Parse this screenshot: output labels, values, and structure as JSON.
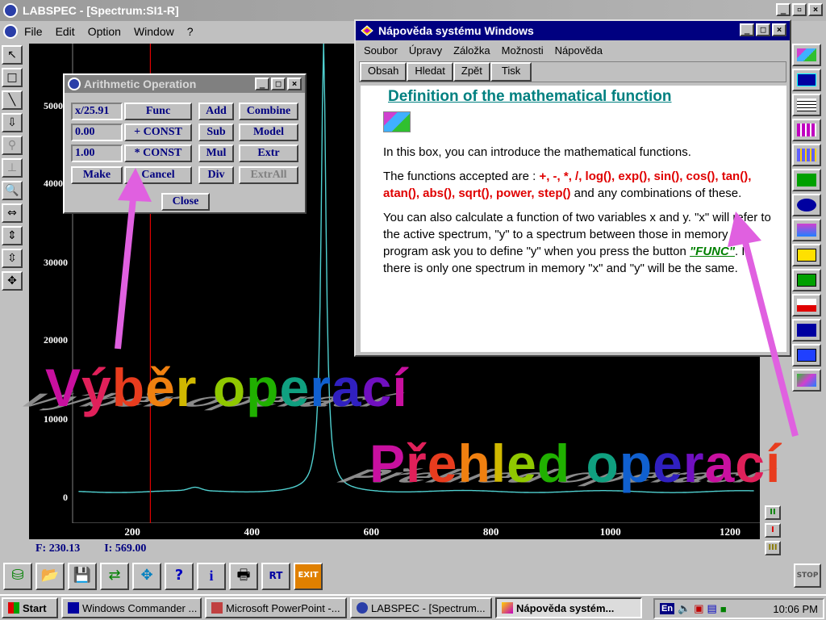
{
  "main_window": {
    "title": "LABSPEC - [Spectrum:SI1-R]",
    "menu": [
      "File",
      "Edit",
      "Option",
      "Window",
      "?"
    ]
  },
  "plot": {
    "y_ticks": [
      "50000",
      "40000",
      "30000",
      "20000",
      "10000",
      "0"
    ],
    "x_ticks": [
      "200",
      "400",
      "600",
      "800",
      "1000",
      "1200"
    ],
    "cursor_x": 230.13,
    "peak_x": 520
  },
  "status": {
    "f_label": "F:  230.13",
    "i_label": "I:  569.00"
  },
  "arithmetic_dialog": {
    "title": "Arithmetic Operation",
    "field1": "x/25.91",
    "field2": "0.00",
    "field3": "1.00",
    "func_label": "Func",
    "add_const_label": "+ CONST",
    "mul_const_label": "* CONST",
    "make_label": "Make",
    "cancel_label": "Cancel",
    "add_label": "Add",
    "sub_label": "Sub",
    "mul_label": "Mul",
    "div_label": "Div",
    "combine_label": "Combine",
    "model_label": "Model",
    "extr_label": "Extr",
    "extrall_label": "ExtrAll",
    "close_label": "Close"
  },
  "help_window": {
    "title": "Nápověda systému Windows",
    "menu": [
      "Soubor",
      "Úpravy",
      "Záložka",
      "Možnosti",
      "Nápověda"
    ],
    "buttons": [
      "Obsah",
      "Hledat",
      "Zpět",
      "Tisk"
    ],
    "heading": "Definition of the mathematical function",
    "p1": "In this box, you can introduce the mathematical functions.",
    "p2_start": "The functions accepted are : ",
    "p2_funcs": "+, -, *, /, log(), exp(), sin(), cos(), tan(), atan(), abs(), sqrt(), power, step()",
    "p2_end": " and any combinations of these.",
    "p3_start": "You can also calculate a function of two variables x and y. \"x\" will refer to the active spectrum, \"y\" to a spectrum between those in memory : the program ask you to define \"y\" when you press the button ",
    "p3_link": "\"FUNC\"",
    "p3_end": ". If there is only one spectrum in memory \"x\" and \"y\" will be the same."
  },
  "captions": {
    "left": [
      "V",
      "ý",
      "b",
      "ě",
      "r",
      " ",
      "o",
      "p",
      "e",
      "r",
      "a",
      "c",
      "í"
    ],
    "right": [
      "P",
      "ř",
      "e",
      "h",
      "l",
      "e",
      "d",
      " ",
      "o",
      "p",
      "e",
      "r",
      "a",
      "c",
      "í"
    ]
  },
  "side_controls": [
    "II",
    "I",
    "III"
  ],
  "stop_label": "STOP",
  "taskbar": {
    "start_label": "Start",
    "tasks": [
      "Windows Commander ...",
      "Microsoft PowerPoint -...",
      "LABSPEC - [Spectrum...",
      "Nápověda systém..."
    ],
    "lang": "En",
    "clock": "10:06 PM"
  },
  "colors": {
    "spectrum": "#50d0d0",
    "cursor": "#e00000",
    "help_title": "#000080"
  }
}
